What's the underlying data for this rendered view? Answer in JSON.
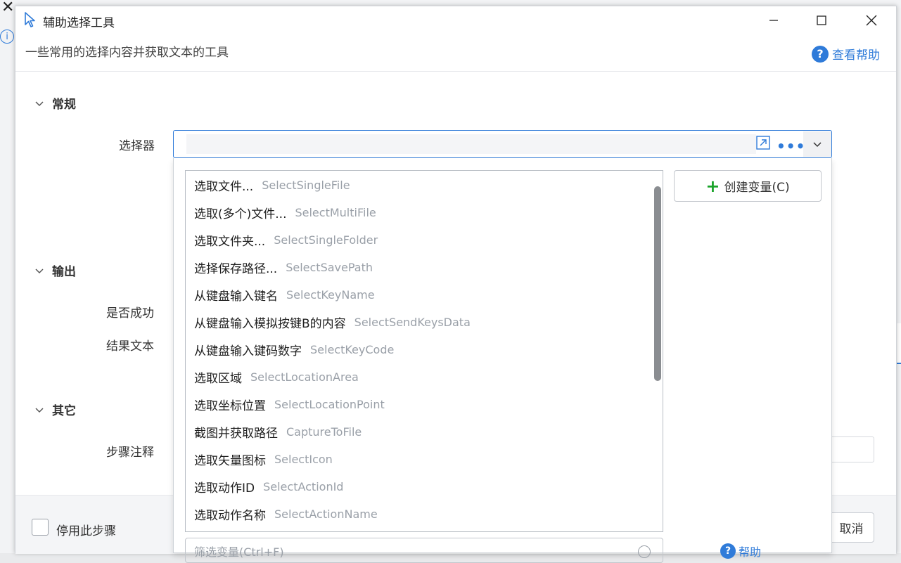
{
  "window": {
    "title": "辅助选择工具",
    "subtitle": "一些常用的选择内容并获取文本的工具",
    "help_label": "查看帮助",
    "minimize_glyph": "—",
    "maximize_glyph": "☐",
    "close_glyph": "✕"
  },
  "sections": {
    "general": "常规",
    "output": "输出",
    "other": "其它"
  },
  "fields": {
    "selector_label": "选择器",
    "success_label": "是否成功",
    "result_label": "结果文本",
    "note_label": "步骤注释"
  },
  "selector": {
    "value": "",
    "more_glyph": "•••"
  },
  "dropdown": {
    "items": [
      {
        "zh": "选取文件...",
        "en": "SelectSingleFile"
      },
      {
        "zh": "选取(多个)文件...",
        "en": "SelectMultiFile"
      },
      {
        "zh": "选取文件夹...",
        "en": "SelectSingleFolder"
      },
      {
        "zh": "选择保存路径...",
        "en": "SelectSavePath"
      },
      {
        "zh": "从键盘输入键名",
        "en": "SelectKeyName"
      },
      {
        "zh": "从键盘输入模拟按键B的内容",
        "en": "SelectSendKeysData"
      },
      {
        "zh": "从键盘输入键码数字",
        "en": "SelectKeyCode"
      },
      {
        "zh": "选取区域",
        "en": "SelectLocationArea"
      },
      {
        "zh": "选取坐标位置",
        "en": "SelectLocationPoint"
      },
      {
        "zh": "截图并获取路径",
        "en": "CaptureToFile"
      },
      {
        "zh": "选取矢量图标",
        "en": "SelectIcon"
      },
      {
        "zh": "选取动作ID",
        "en": "SelectActionId"
      },
      {
        "zh": "选取动作名称",
        "en": "SelectActionName"
      }
    ],
    "create_variable_label": "创建变量(C)",
    "filter_placeholder": "筛选变量(Ctrl+F)",
    "help_label": "帮助"
  },
  "footer": {
    "disable_step_label": "停用此步骤",
    "cancel_label": "取消"
  },
  "background": {
    "info_glyph": "i",
    "right_glyph": "夕"
  },
  "colors": {
    "accent": "#2f7bd9",
    "plus_green": "#1aa32a"
  }
}
